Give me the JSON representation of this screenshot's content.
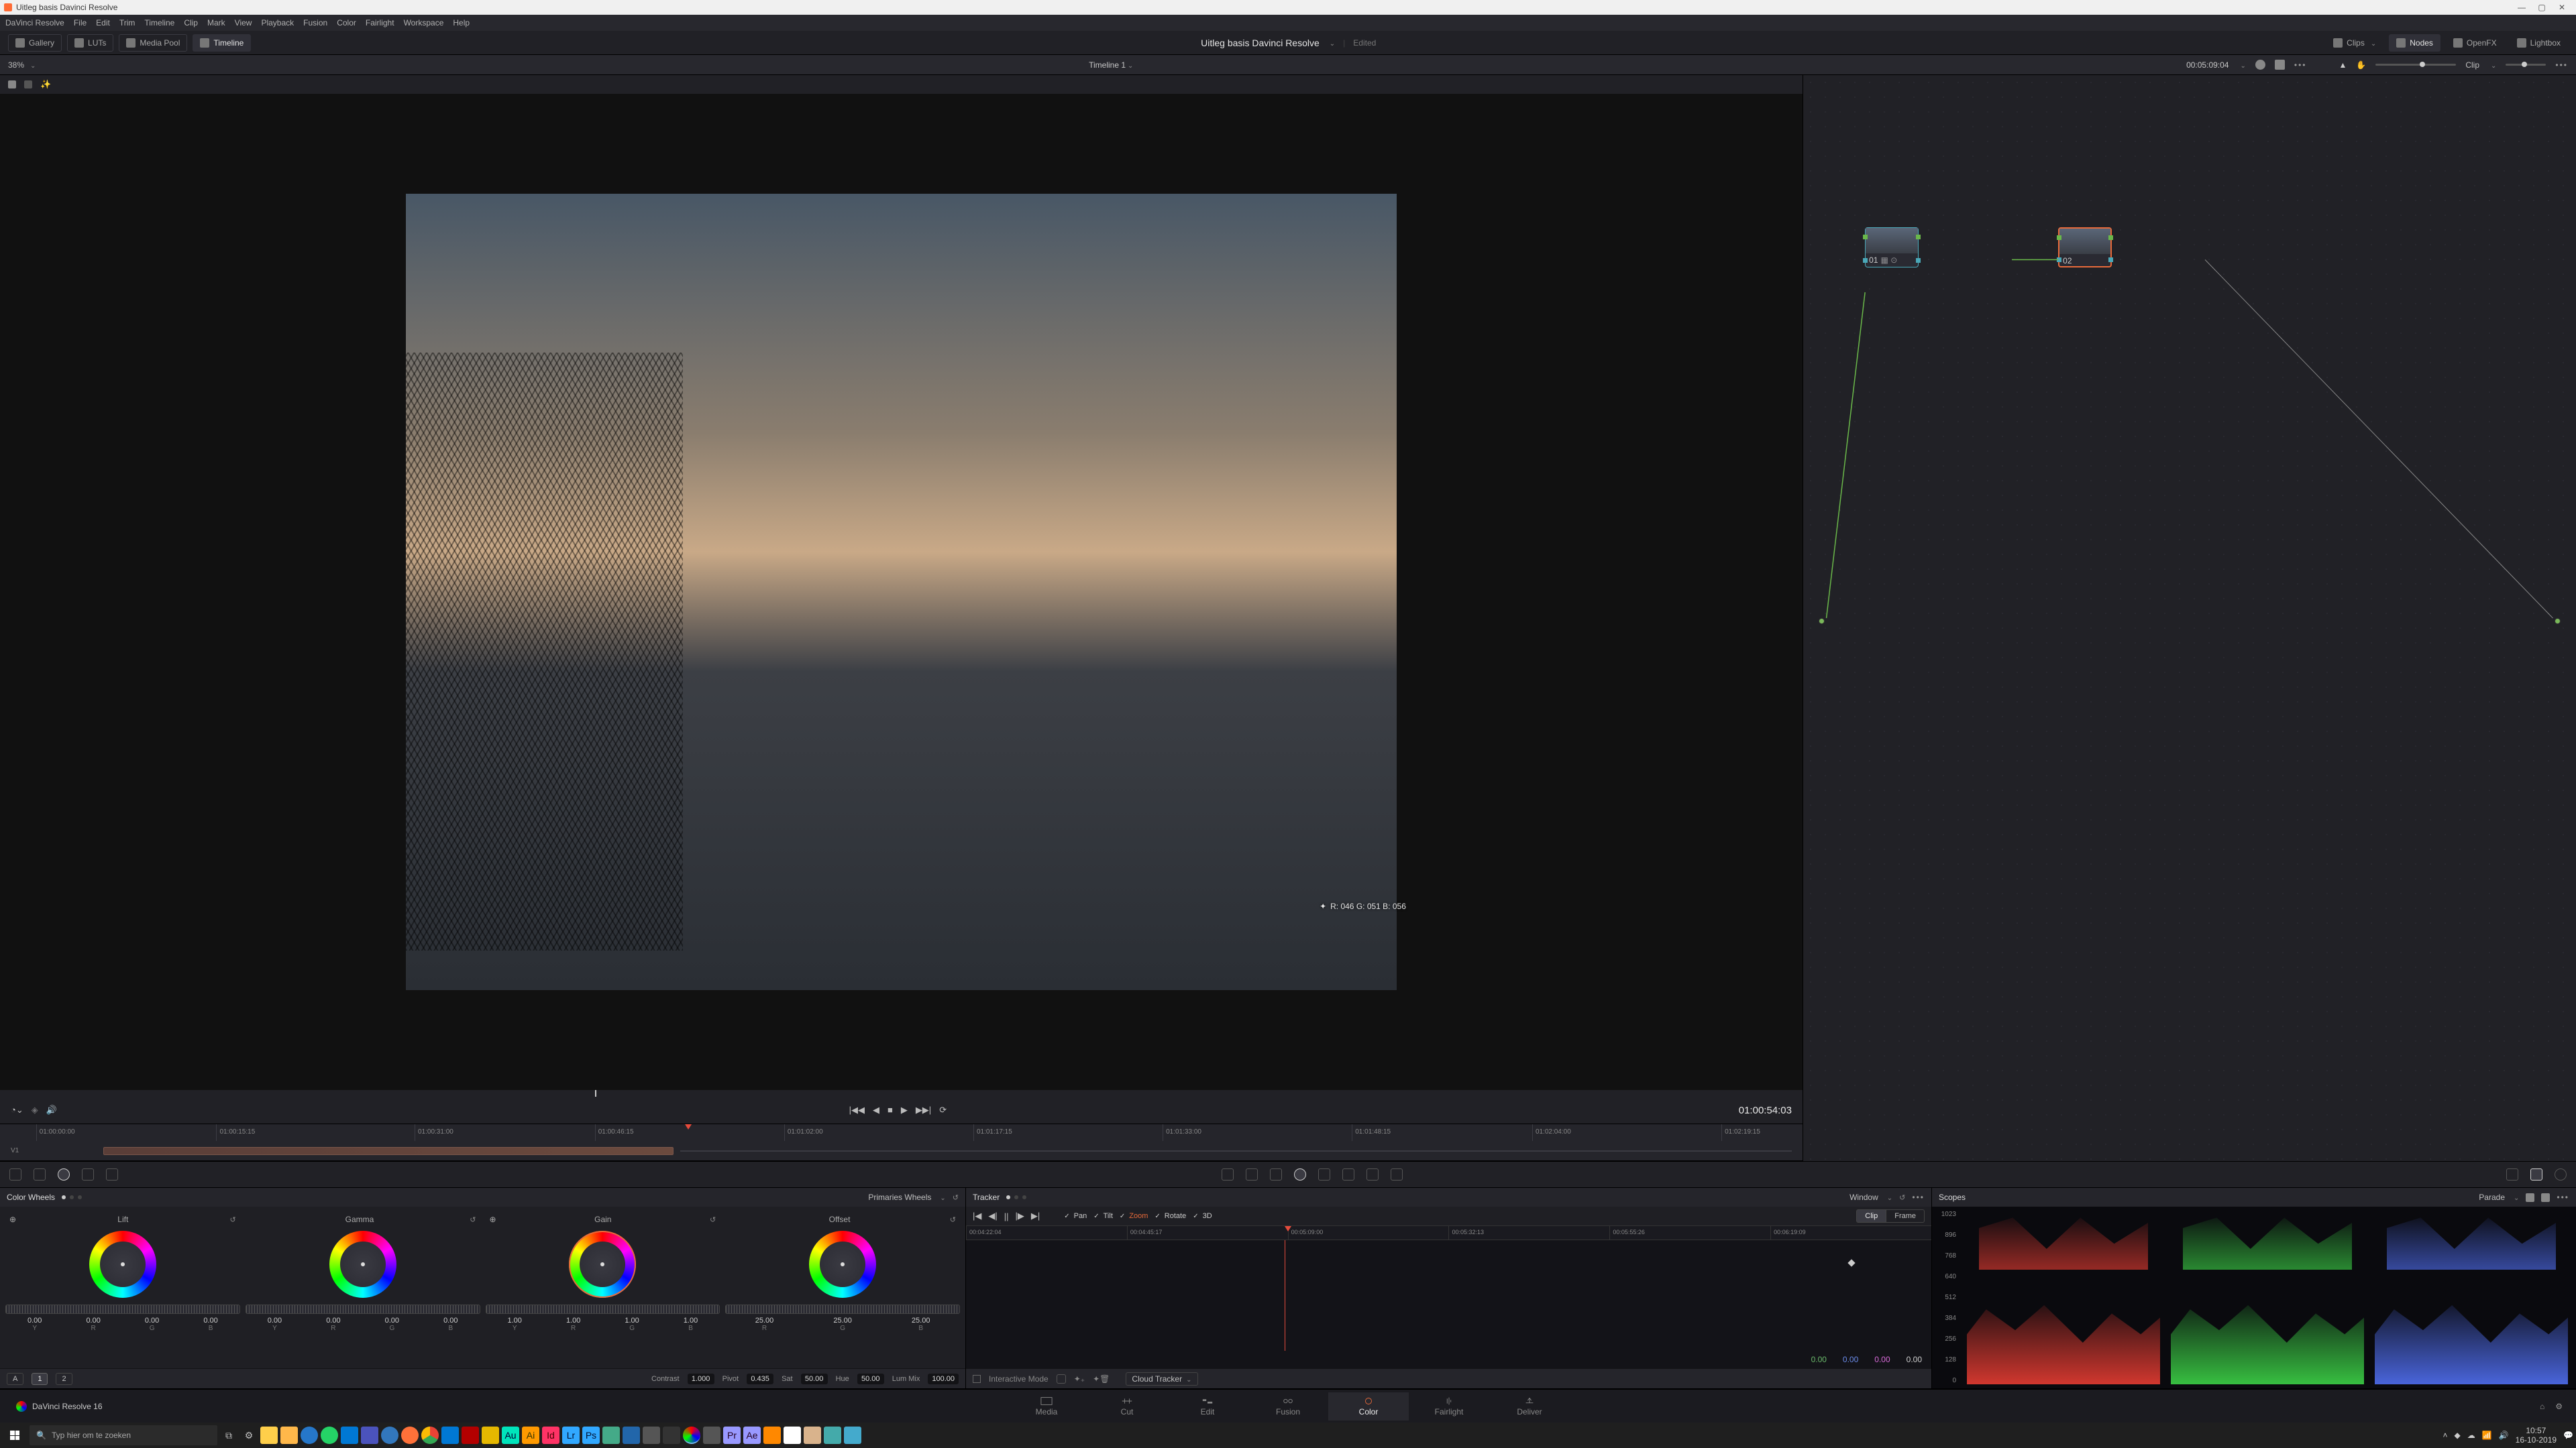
{
  "window": {
    "title": "Uitleg basis Davinci Resolve",
    "min": "—",
    "max": "▢",
    "close": "✕"
  },
  "menu": [
    "DaVinci Resolve",
    "File",
    "Edit",
    "Trim",
    "Timeline",
    "Clip",
    "Mark",
    "View",
    "Playback",
    "Fusion",
    "Color",
    "Fairlight",
    "Workspace",
    "Help"
  ],
  "top_tools": {
    "left": {
      "gallery": "Gallery",
      "luts": "LUTs",
      "mediapool": "Media Pool",
      "timeline": "Timeline"
    },
    "project": "Uitleg basis Davinci Resolve",
    "edited": "Edited",
    "right": {
      "clips": "Clips",
      "nodes": "Nodes",
      "openfx": "OpenFX",
      "lightbox": "Lightbox"
    }
  },
  "subrow": {
    "zoom": "38%",
    "timeline_name": "Timeline 1",
    "source_tc": "00:05:09:04",
    "clip_label": "Clip"
  },
  "viewer": {
    "pixel_readout": "R: 046 G: 051 B: 056",
    "timecode": "01:00:54:03"
  },
  "ruler_ticks": [
    "01:00:00:00",
    "01:00:15:15",
    "01:00:31:00",
    "01:00:46:15",
    "01:01:02:00",
    "01:01:17:15",
    "01:01:33:00",
    "01:01:48:15",
    "01:02:04:00",
    "01:02:19:15"
  ],
  "track": "V1",
  "color_wheels": {
    "title": "Color Wheels",
    "mode": "Primaries Wheels",
    "wheels": [
      {
        "name": "Lift",
        "vals": [
          "0.00",
          "0.00",
          "0.00",
          "0.00"
        ],
        "labels": [
          "Y",
          "R",
          "G",
          "B"
        ]
      },
      {
        "name": "Gamma",
        "vals": [
          "0.00",
          "0.00",
          "0.00",
          "0.00"
        ],
        "labels": [
          "Y",
          "R",
          "G",
          "B"
        ]
      },
      {
        "name": "Gain",
        "vals": [
          "1.00",
          "1.00",
          "1.00",
          "1.00"
        ],
        "labels": [
          "Y",
          "R",
          "G",
          "B"
        ]
      },
      {
        "name": "Offset",
        "vals": [
          "25.00",
          "25.00",
          "25.00"
        ],
        "labels": [
          "R",
          "G",
          "B"
        ]
      }
    ],
    "adjust": {
      "a": "A",
      "one": "1",
      "two": "2",
      "contrast_lbl": "Contrast",
      "contrast": "1.000",
      "pivot_lbl": "Pivot",
      "pivot": "0.435",
      "sat_lbl": "Sat",
      "sat": "50.00",
      "hue_lbl": "Hue",
      "hue": "50.00",
      "lummix_lbl": "Lum Mix",
      "lummix": "100.00"
    }
  },
  "tracker": {
    "title": "Tracker",
    "mode": "Window",
    "opts": {
      "pan": "Pan",
      "tilt": "Tilt",
      "zoom": "Zoom",
      "rotate": "Rotate",
      "threeD": "3D"
    },
    "seg": {
      "clip": "Clip",
      "frame": "Frame"
    },
    "ticks": [
      "00:04:22:04",
      "00:04:45:17",
      "00:05:09:00",
      "00:05:32:13",
      "00:05:55:26",
      "00:06:19:09"
    ],
    "readout": [
      "0.00",
      "0.00",
      "0.00",
      "0.00"
    ],
    "interactive": "Interactive Mode",
    "cloud": "Cloud Tracker"
  },
  "scopes": {
    "title": "Scopes",
    "mode": "Parade",
    "scale": [
      "1023",
      "896",
      "768",
      "640",
      "512",
      "384",
      "256",
      "128",
      "0"
    ]
  },
  "nodes": {
    "n1": "01",
    "n2": "02"
  },
  "pages": [
    "Media",
    "Cut",
    "Edit",
    "Fusion",
    "Color",
    "Fairlight",
    "Deliver"
  ],
  "brand": "DaVinci Resolve 16",
  "taskbar": {
    "search_placeholder": "Typ hier om te zoeken",
    "time": "10:57",
    "date": "16-10-2019"
  }
}
